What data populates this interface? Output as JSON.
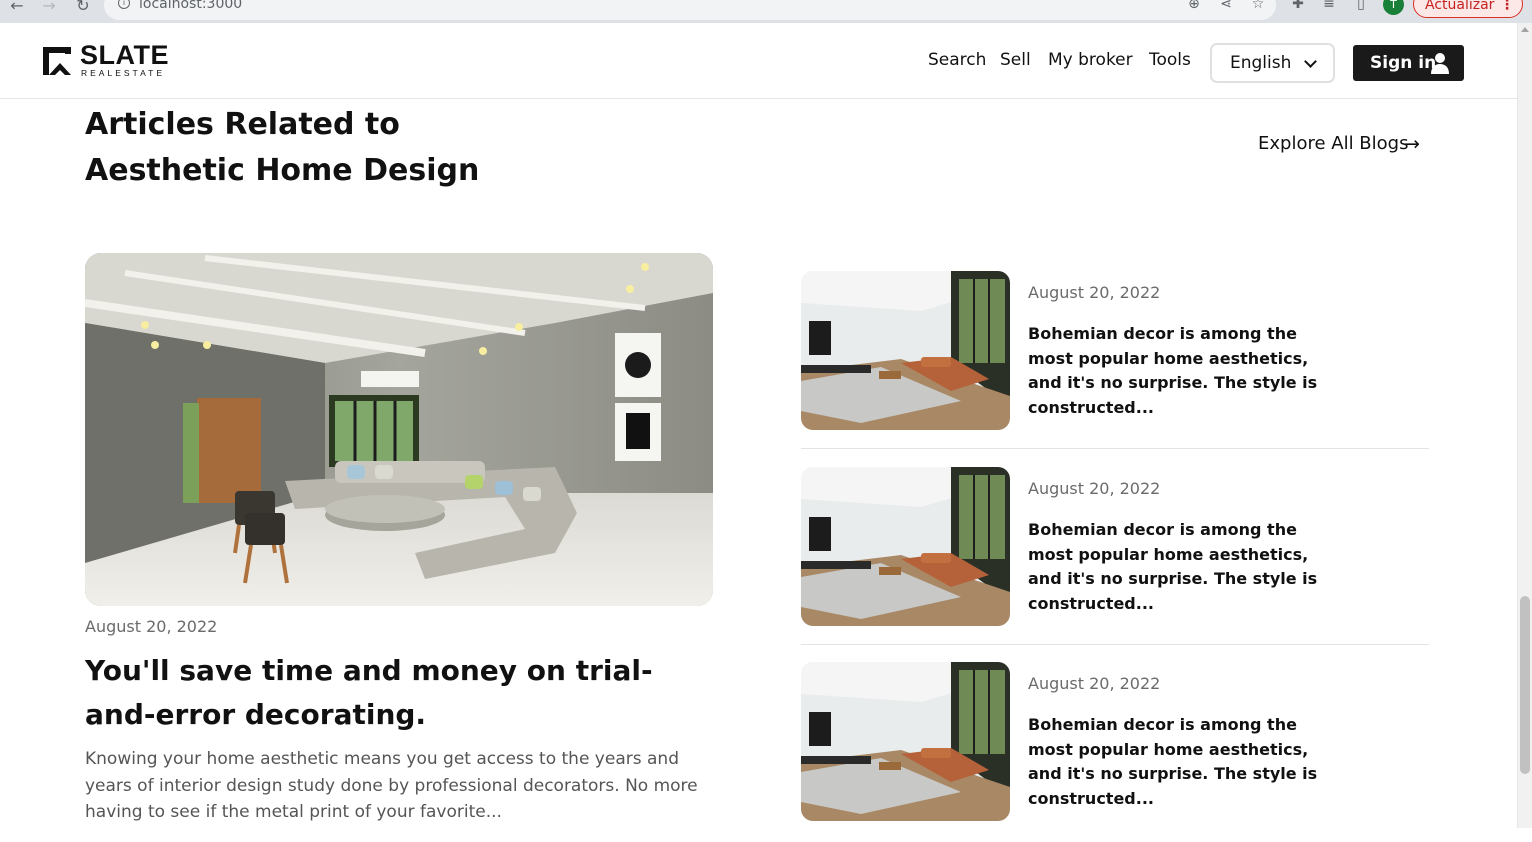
{
  "browser": {
    "url": "localhost:3000",
    "update_label": "Actualizar",
    "profile_initial": "T"
  },
  "header": {
    "logo_name": "SLATE",
    "logo_tag": "REALESTATE",
    "nav": [
      "Search",
      "Sell",
      "My broker",
      "Tools"
    ],
    "language": "English",
    "signin_label": "Sign in"
  },
  "section": {
    "title": "Articles Related to Aesthetic Home Design",
    "explore_label": "Explore All Blogs"
  },
  "featured": {
    "date": "August 20, 2022",
    "title": "You'll save time and money on trial-and-error decorating.",
    "excerpt": "Knowing your home aesthetic means you get access to the years and years of interior design study done by professional decorators. No more having to see if the metal print of your favorite..."
  },
  "side_articles": [
    {
      "date": "August 20, 2022",
      "excerpt": "Bohemian decor is among the most popular home aesthetics, and it's no surprise. The style is constructed..."
    },
    {
      "date": "August 20, 2022",
      "excerpt": "Bohemian decor is among the most popular home aesthetics, and it's no surprise. The style is constructed..."
    },
    {
      "date": "August 20, 2022",
      "excerpt": "Bohemian decor is among the most popular home aesthetics, and it's no surprise. The style is constructed..."
    }
  ],
  "colors": {
    "accent": "#1a1a1a",
    "muted_text": "#6b6b6b",
    "update_red": "#c5221f"
  }
}
